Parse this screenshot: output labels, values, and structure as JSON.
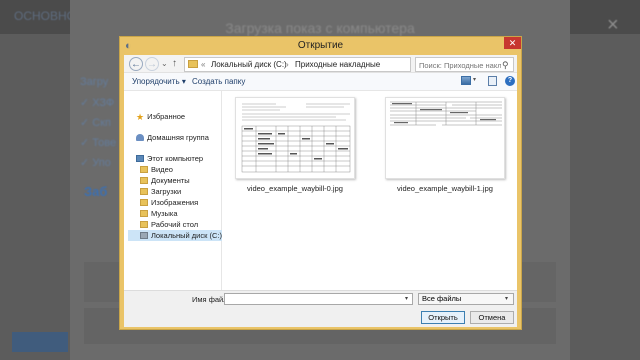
{
  "dialog": {
    "title": "Открытие",
    "close_glyph": "✕"
  },
  "nav": {
    "back_glyph": "←",
    "forward_glyph": "→",
    "recent_glyph": "⌄",
    "up_glyph": "↑",
    "address_sep": "«",
    "address_segments": [
      "Локальный диск (C:)",
      "Приходные накладные"
    ],
    "address_arrow": "›",
    "dropdown_glyph": "▾",
    "refresh_glyph": "↻",
    "search_placeholder": "Поиск: Приходные накладные",
    "search_glyph": "⚲"
  },
  "toolbar": {
    "organize_label": "Упорядочить ▾",
    "new_folder_label": "Создать папку",
    "view_dd_glyph": "▾",
    "help_glyph": "?"
  },
  "navpane": {
    "favorites": "Избранное",
    "homegroup": "Домашняя группа",
    "computer": "Этот компьютер",
    "items": [
      "Видео",
      "Документы",
      "Загрузки",
      "Изображения",
      "Музыка",
      "Рабочий стол",
      "Локальный диск (C:)"
    ]
  },
  "files": [
    {
      "name": "video_example_waybill-0.jpg"
    },
    {
      "name": "video_example_waybill-1.jpg"
    }
  ],
  "bottom": {
    "filename_label": "Имя файла:",
    "filename_value": "",
    "filetype_value": "Все файлы",
    "dropdown_glyph": "▾",
    "open_label": "Открыть",
    "cancel_label": "Отмена"
  },
  "background": {
    "app_title_fragment": "ОСНОВНОЕ",
    "modal_title": "Загрузка показ с компьютера",
    "close_glyph": "×",
    "left_items": [
      "Загру",
      "✓ ХЗФ",
      "✓ Скп",
      "✓ Тове",
      "✓ Упо"
    ],
    "blue_text": "Заб"
  }
}
